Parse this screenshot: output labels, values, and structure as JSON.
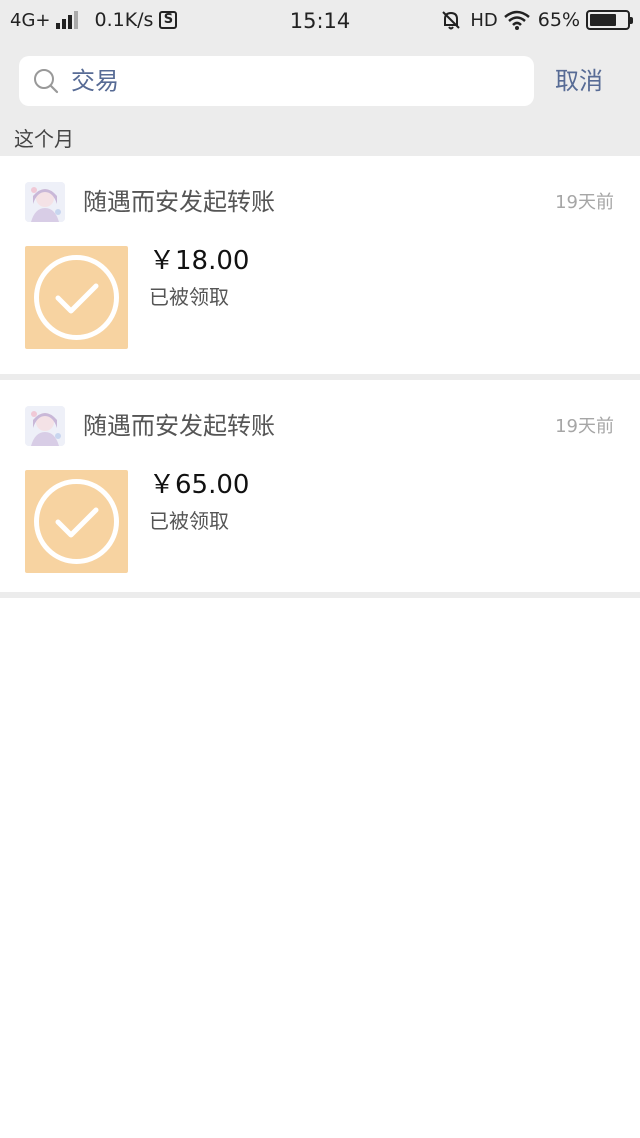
{
  "status_bar": {
    "network": "4G+",
    "speed": "0.1K/s",
    "s_icon": "S",
    "time": "15:14",
    "hd": "HD",
    "battery": "65%"
  },
  "search": {
    "query": "交易",
    "cancel_label": "取消"
  },
  "section": {
    "label": "这个月"
  },
  "transactions": [
    {
      "sender": "随遇而安发起转账",
      "time": "19天前",
      "amount": "￥18.00",
      "status": "已被领取"
    },
    {
      "sender": "随遇而安发起转账",
      "time": "19天前",
      "amount": "￥65.00",
      "status": "已被领取"
    }
  ],
  "icons": {
    "search": "search-icon",
    "transfer": "check-circle-icon",
    "wifi": "wifi-icon",
    "battery": "battery-icon",
    "bell_off": "bell-off-icon"
  },
  "colors": {
    "link": "#576b95",
    "transfer_bg": "#f7d3a1",
    "page_bg": "#ececec"
  }
}
